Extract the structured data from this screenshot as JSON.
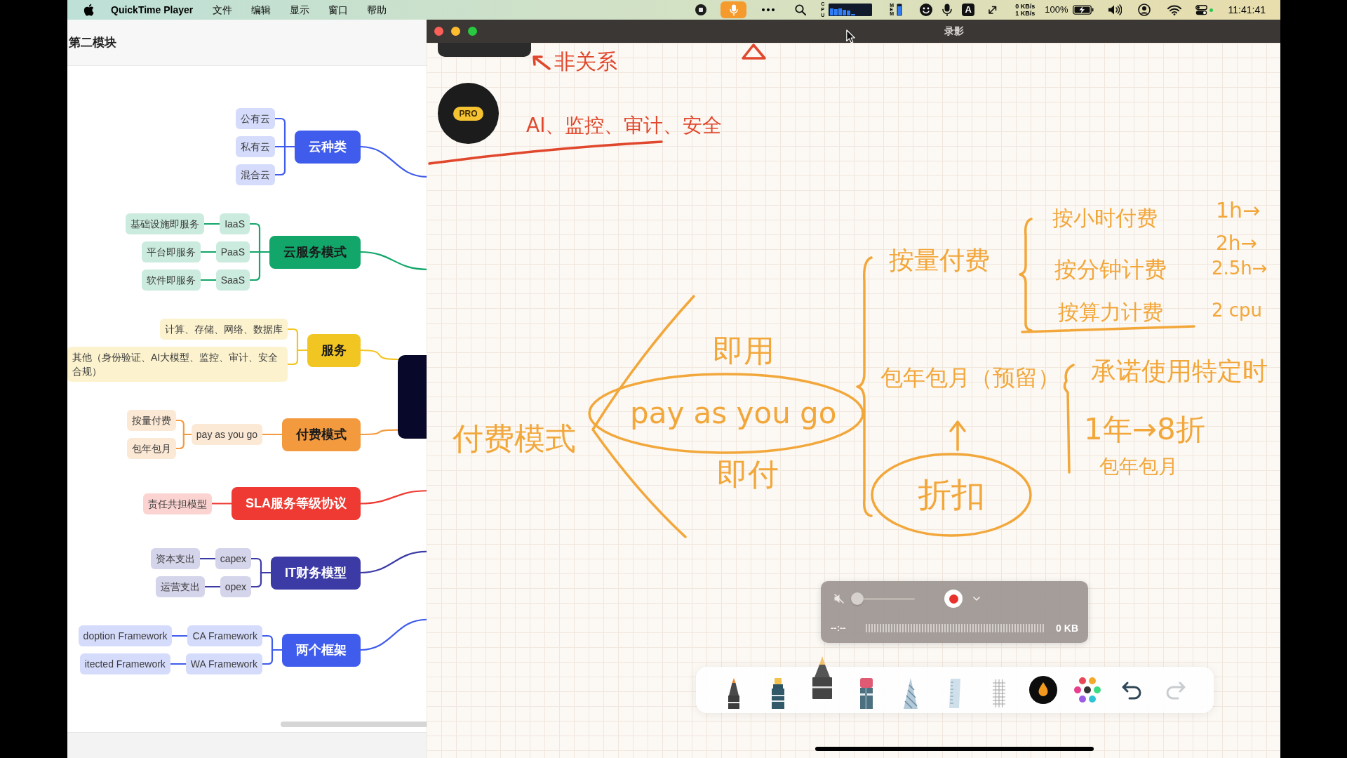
{
  "menu_bar": {
    "app_name": "QuickTime Player",
    "menus": [
      "文件",
      "编辑",
      "显示",
      "窗口",
      "帮助"
    ],
    "cpu_label": "CPU",
    "mem_label": "MEM",
    "input_source": "A",
    "network_upload": "0 KB/s",
    "network_download": "1 KB/s",
    "battery": "100%",
    "clock": "11:41:41"
  },
  "mind_map_window": {
    "title": "第二模块",
    "branches": [
      {
        "label": "云种类",
        "color": "#3f5cec",
        "children": [
          {
            "label": "公有云"
          },
          {
            "label": "私有云"
          },
          {
            "label": "混合云"
          }
        ]
      },
      {
        "label": "云服务模式",
        "color": "#12a66a",
        "children": [
          {
            "label": "IaaS",
            "children": [
              {
                "label": "基础设施即服务"
              }
            ]
          },
          {
            "label": "PaaS",
            "children": [
              {
                "label": "平台即服务"
              }
            ]
          },
          {
            "label": "SaaS",
            "children": [
              {
                "label": "软件即服务"
              }
            ]
          }
        ]
      },
      {
        "label": "服务",
        "color": "#f2c622",
        "children": [
          {
            "label": "计算、存储、网络、数据库"
          },
          {
            "label": "其他（身份验证、AI大模型、监控、审计、安全合规）"
          }
        ]
      },
      {
        "label": "付费模式",
        "color": "#f39a3e",
        "children": [
          {
            "label": "pay as you go",
            "children": [
              {
                "label": "按量付费"
              },
              {
                "label": "包年包月"
              }
            ]
          }
        ]
      },
      {
        "label": "SLA服务等级协议",
        "color": "#ee3a32",
        "children": [
          {
            "label": "责任共担模型"
          }
        ]
      },
      {
        "label": "IT财务模型",
        "color": "#3c3ba6",
        "children": [
          {
            "label": "capex",
            "children": [
              {
                "label": "资本支出"
              }
            ]
          },
          {
            "label": "opex",
            "children": [
              {
                "label": "运营支出"
              }
            ]
          }
        ]
      },
      {
        "label": "两个框架",
        "color": "#3f5cec",
        "children": [
          {
            "label": "CA Framework",
            "children": [
              {
                "label": "doption Framework"
              }
            ]
          },
          {
            "label": "WA Framework",
            "children": [
              {
                "label": "itected Framework"
              }
            ]
          }
        ]
      }
    ]
  },
  "recording_window": {
    "title": "录影",
    "pro_badge": "PRO",
    "notes": [
      {
        "text": "非关系",
        "color": "#e0472c"
      },
      {
        "text": "AI、监控、审计、安全",
        "color": "#e0472c"
      },
      {
        "text": "按小时付费",
        "color": "#f2a73b"
      },
      {
        "text": "1h→",
        "color": "#f2a73b"
      },
      {
        "text": "按量付费",
        "color": "#f2a73b"
      },
      {
        "text": "2h→",
        "color": "#f2a73b"
      },
      {
        "text": "按分钟计费",
        "color": "#f2a73b"
      },
      {
        "text": "2.5h→",
        "color": "#f2a73b"
      },
      {
        "text": "按算力计费",
        "color": "#f2a73b"
      },
      {
        "text": "2 cpu",
        "color": "#f2a73b"
      },
      {
        "text": "即用",
        "color": "#f2a73b"
      },
      {
        "text": "包年包月（预留）",
        "color": "#f2a73b"
      },
      {
        "text": "承诺使用特定时",
        "color": "#f2a73b"
      },
      {
        "text": "付费模式",
        "color": "#f2a73b"
      },
      {
        "text": "pay as you go",
        "color": "#f2a73b"
      },
      {
        "text": "1年→8折",
        "color": "#f2a73b"
      },
      {
        "text": "即付",
        "color": "#f2a73b"
      },
      {
        "text": "折扣",
        "color": "#f2a73b"
      },
      {
        "text": "包年包月",
        "color": "#f2a73b"
      }
    ],
    "recording_controls": {
      "muted": true,
      "volume": {
        "level": 0
      },
      "time": "--:--",
      "file_size": "0 KB"
    },
    "toolbar": {
      "tools": [
        {
          "kind": "pen",
          "selected": false
        },
        {
          "kind": "highlighter",
          "selected": false
        },
        {
          "kind": "marker",
          "selected": true
        },
        {
          "kind": "eraser",
          "selected": false
        },
        {
          "kind": "pattern",
          "selected": false
        },
        {
          "kind": "ruler",
          "selected": false
        },
        {
          "kind": "texture",
          "selected": false
        }
      ],
      "undo": {
        "disabled": false
      },
      "redo": {
        "disabled": true
      }
    }
  }
}
